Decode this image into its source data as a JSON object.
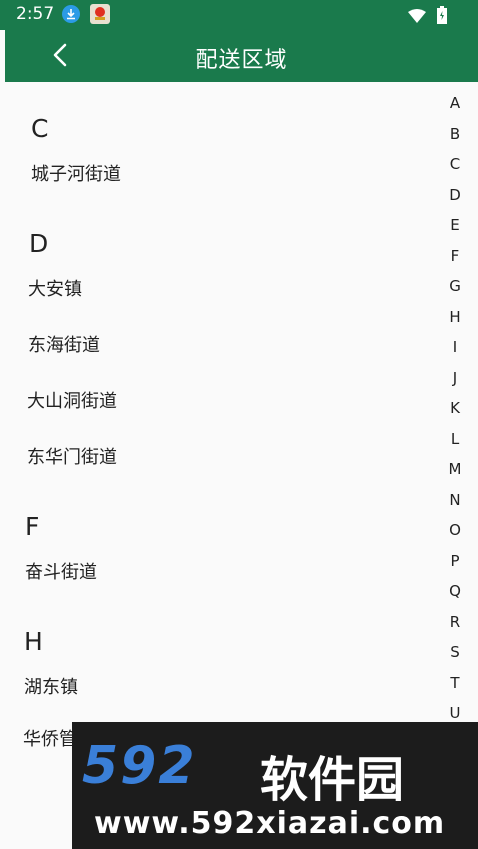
{
  "status_bar": {
    "time": "2:57",
    "icons": [
      "download-icon",
      "app-notification-icon",
      "wifi-icon",
      "battery-icon"
    ]
  },
  "app_bar": {
    "title": "配送区域",
    "back_icon": "chevron-left-icon",
    "color": "#1a7a4c"
  },
  "sections": [
    {
      "letter": "C",
      "items": [
        "城子河街道"
      ]
    },
    {
      "letter": "D",
      "items": [
        "大安镇",
        "东海街道",
        "大山洞街道",
        "东华门街道"
      ]
    },
    {
      "letter": "F",
      "items": [
        "奋斗街道"
      ]
    },
    {
      "letter": "H",
      "items": [
        "湖东镇",
        "华侨管"
      ]
    }
  ],
  "index_letters": [
    "A",
    "B",
    "C",
    "D",
    "E",
    "F",
    "G",
    "H",
    "I",
    "J",
    "K",
    "L",
    "M",
    "N",
    "O",
    "P",
    "Q",
    "R",
    "S",
    "T",
    "U"
  ],
  "watermark": {
    "number": "592",
    "name": "软件园",
    "url": "www.592xiazai.com"
  }
}
